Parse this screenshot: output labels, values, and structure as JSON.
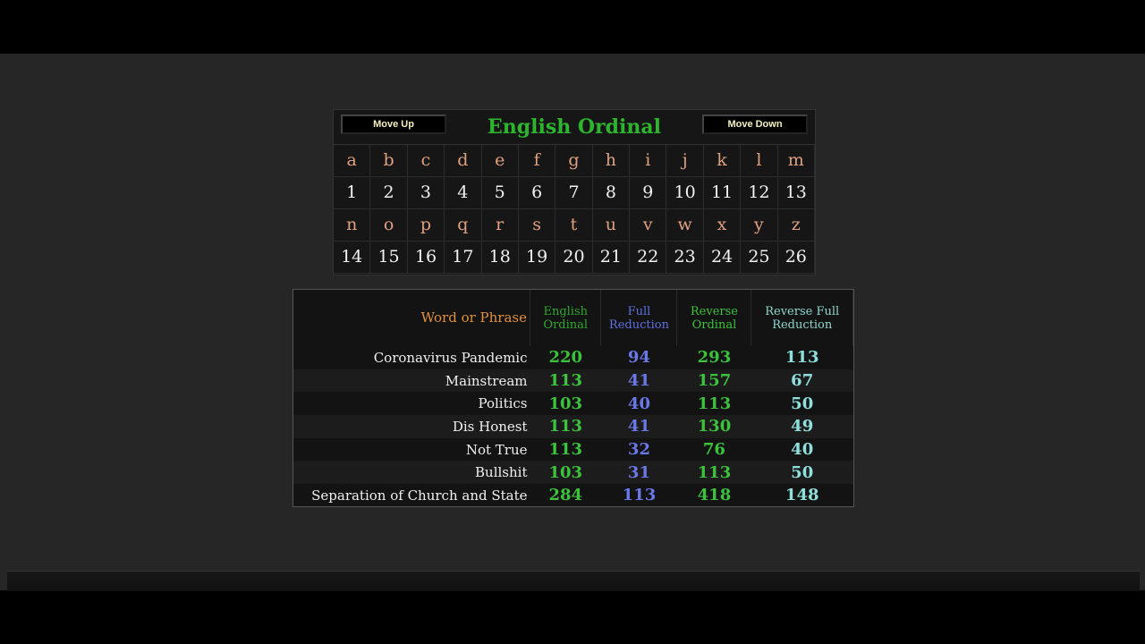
{
  "cipher": {
    "title": "English Ordinal",
    "move_up": "Move Up",
    "move_down": "Move Down",
    "rows": [
      {
        "letters": [
          "a",
          "b",
          "c",
          "d",
          "e",
          "f",
          "g",
          "h",
          "i",
          "j",
          "k",
          "l",
          "m"
        ],
        "values": [
          "1",
          "2",
          "3",
          "4",
          "5",
          "6",
          "7",
          "8",
          "9",
          "10",
          "11",
          "12",
          "13"
        ]
      },
      {
        "letters": [
          "n",
          "o",
          "p",
          "q",
          "r",
          "s",
          "t",
          "u",
          "v",
          "w",
          "x",
          "y",
          "z"
        ],
        "values": [
          "14",
          "15",
          "16",
          "17",
          "18",
          "19",
          "20",
          "21",
          "22",
          "23",
          "24",
          "25",
          "26"
        ]
      }
    ]
  },
  "results": {
    "headers": [
      "Word or Phrase",
      "English Ordinal",
      "Full Reduction",
      "Reverse Ordinal",
      "Reverse Full Reduction"
    ],
    "colors": {
      "english_ordinal": "#3cc23c",
      "full_reduction": "#6b78e8",
      "reverse_ordinal": "#3cc23c",
      "reverse_full_reduction": "#8fe0dc",
      "phrase_header": "#e0913e"
    },
    "rows": [
      {
        "phrase": "Coronavirus Pandemic",
        "values": [
          "220",
          "94",
          "293",
          "113"
        ]
      },
      {
        "phrase": "Mainstream",
        "values": [
          "113",
          "41",
          "157",
          "67"
        ]
      },
      {
        "phrase": "Politics",
        "values": [
          "103",
          "40",
          "113",
          "50"
        ]
      },
      {
        "phrase": "Dis Honest",
        "values": [
          "113",
          "41",
          "130",
          "49"
        ]
      },
      {
        "phrase": "Not True",
        "values": [
          "113",
          "32",
          "76",
          "40"
        ]
      },
      {
        "phrase": "Bullshit",
        "values": [
          "103",
          "31",
          "113",
          "50"
        ]
      },
      {
        "phrase": "Separation of Church and State",
        "values": [
          "284",
          "113",
          "418",
          "148"
        ]
      }
    ]
  }
}
